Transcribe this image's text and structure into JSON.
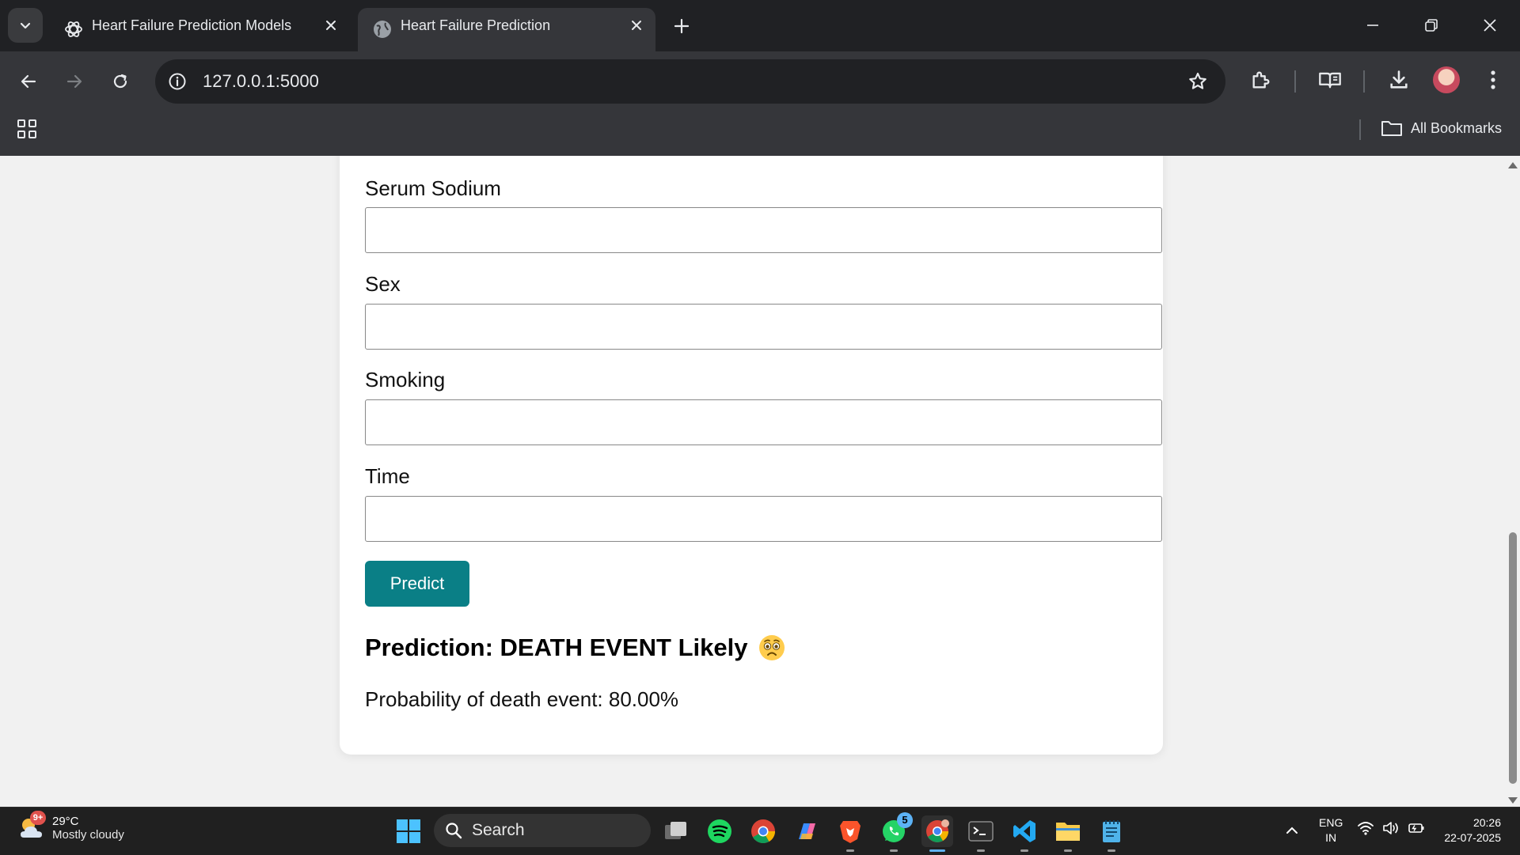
{
  "browser": {
    "tabs": [
      {
        "title": "Heart Failure Prediction Models",
        "favicon": "openai-icon",
        "active": false
      },
      {
        "title": "Heart Failure Prediction",
        "favicon": "globe-icon",
        "active": true
      }
    ],
    "url": "127.0.0.1:5000",
    "bookmarks_label": "All Bookmarks"
  },
  "form": {
    "fields": [
      {
        "label": "Serum Sodium",
        "value": ""
      },
      {
        "label": "Sex",
        "value": ""
      },
      {
        "label": "Smoking",
        "value": ""
      },
      {
        "label": "Time",
        "value": ""
      }
    ],
    "submit_label": "Predict"
  },
  "result": {
    "prediction": "Prediction: DEATH EVENT Likely",
    "emoji": "anxious-face-emoji",
    "probability": "Probability of death event: 80.00%"
  },
  "taskbar": {
    "weather_badge": "9+",
    "weather_temp": "29°C",
    "weather_desc": "Mostly cloudy",
    "search_label": "Search",
    "whatsapp_badge": "5",
    "lang_top": "ENG",
    "lang_bottom": "IN",
    "time": "20:26",
    "date": "22-07-2025"
  },
  "colors": {
    "predict_button": "#0a7f86",
    "chrome_dark": "#202124",
    "chrome_toolbar": "#35363a"
  }
}
